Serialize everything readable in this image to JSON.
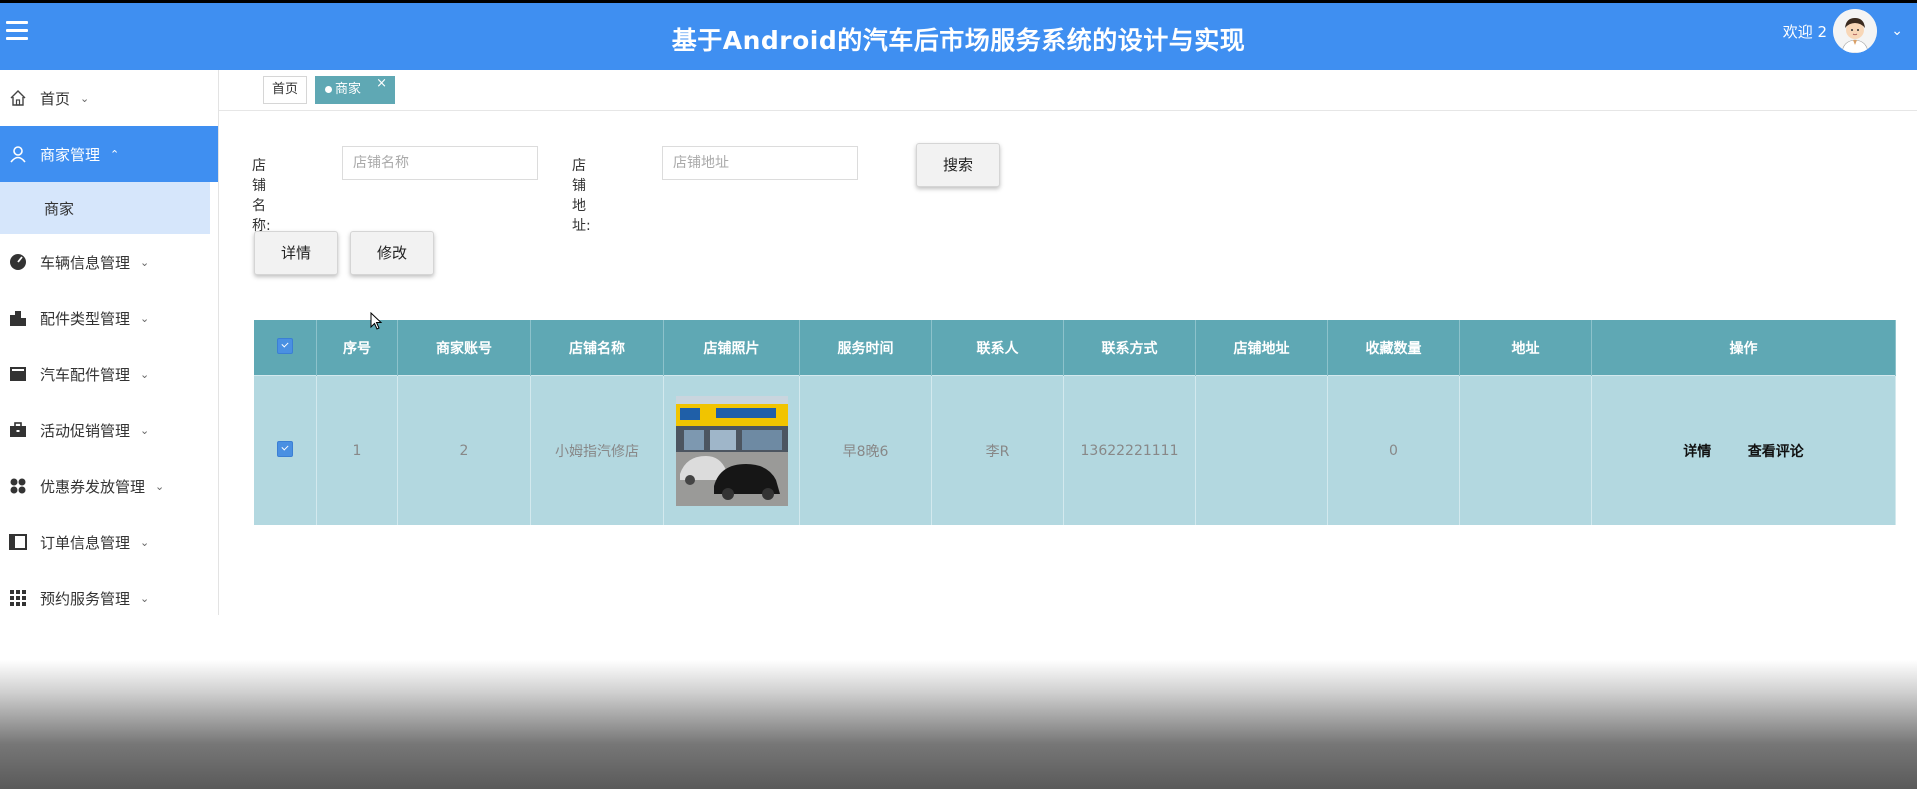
{
  "header": {
    "title": "基于Android的汽车后市场服务系统的设计与实现",
    "welcome": "欢迎 2"
  },
  "sidebar": {
    "items": [
      {
        "label": "首页",
        "icon": "home-icon"
      },
      {
        "label": "商家管理",
        "icon": "user-icon",
        "active": true
      },
      {
        "label": "车辆信息管理",
        "icon": "gauge-icon"
      },
      {
        "label": "配件类型管理",
        "icon": "building-icon"
      },
      {
        "label": "汽车配件管理",
        "icon": "square-icon"
      },
      {
        "label": "活动促销管理",
        "icon": "briefcase-icon"
      },
      {
        "label": "优惠券发放管理",
        "icon": "grid-dots-icon"
      },
      {
        "label": "订单信息管理",
        "icon": "book-icon"
      },
      {
        "label": "预约服务管理",
        "icon": "apps-icon"
      }
    ],
    "sub_item": "商家"
  },
  "tabs": {
    "home": "首页",
    "current": "商家",
    "close": "×"
  },
  "search": {
    "name_label": "店铺名称:",
    "name_placeholder": "店铺名称",
    "address_label": "店铺地址:",
    "address_placeholder": "店铺地址",
    "button": "搜索"
  },
  "actions": {
    "detail": "详情",
    "edit": "修改"
  },
  "table": {
    "columns": [
      "序号",
      "商家账号",
      "店铺名称",
      "店铺照片",
      "服务时间",
      "联系人",
      "联系方式",
      "店铺地址",
      "收藏数量",
      "地址",
      "操作"
    ],
    "rows": [
      {
        "index": "1",
        "account": "2",
        "shop_name": "小姆指汽修店",
        "service_time": "早8晚6",
        "contact": "李R",
        "phone": "13622221111",
        "shop_address": "",
        "favorites": "0",
        "address": "",
        "op_detail": "详情",
        "op_reviews": "查看评论"
      }
    ]
  },
  "colors": {
    "header": "#3f8ff1",
    "table_header": "#5fa8b4",
    "table_row": "#b3d8e0",
    "active_nav": "#3f8ff1"
  }
}
